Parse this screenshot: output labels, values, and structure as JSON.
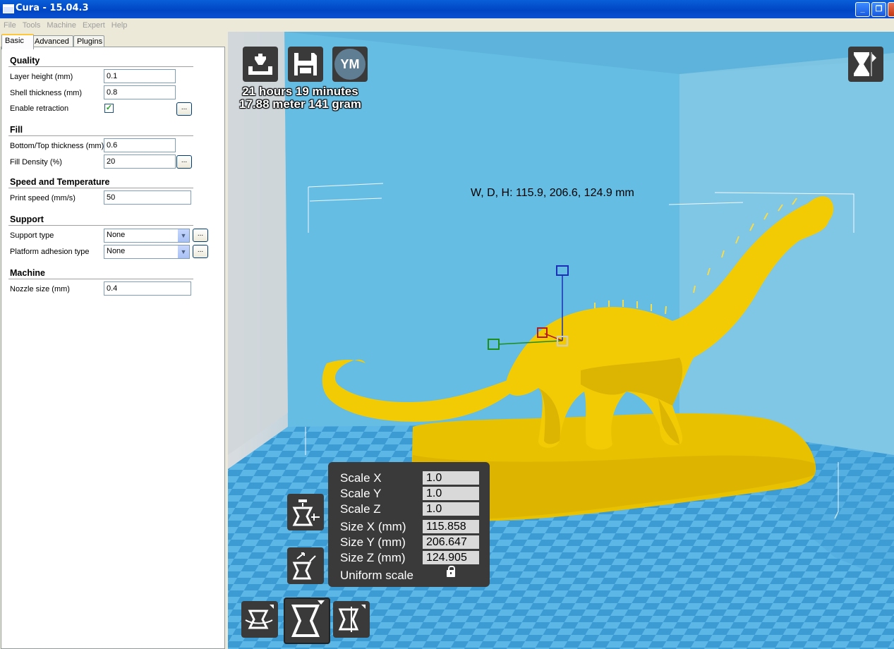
{
  "window": {
    "title": "Cura - 15.04.3"
  },
  "menu": [
    "File",
    "Tools",
    "Machine",
    "Expert",
    "Help"
  ],
  "tabs": [
    "Basic",
    "Advanced",
    "Plugins"
  ],
  "settings": {
    "quality": {
      "header": "Quality",
      "layer_height_label": "Layer height (mm)",
      "layer_height": "0.1",
      "shell_thickness_label": "Shell thickness (mm)",
      "shell_thickness": "0.8",
      "retraction_label": "Enable retraction",
      "retraction_checked": true
    },
    "fill": {
      "header": "Fill",
      "bottom_top_label": "Bottom/Top thickness (mm)",
      "bottom_top": "0.6",
      "density_label": "Fill Density (%)",
      "density": "20"
    },
    "speed": {
      "header": "Speed and Temperature",
      "print_speed_label": "Print speed (mm/s)",
      "print_speed": "50"
    },
    "support": {
      "header": "Support",
      "support_type_label": "Support type",
      "support_type": "None",
      "adhesion_label": "Platform adhesion type",
      "adhesion": "None"
    },
    "machine": {
      "header": "Machine",
      "nozzle_label": "Nozzle size (mm)",
      "nozzle": "0.4"
    },
    "dots_label": "..."
  },
  "viewport": {
    "print_time": "21 hours 19 minutes",
    "print_material": "17.88 meter 141 gram",
    "ym_label": "YM",
    "dimensions": "W, D, H: 115.9, 206.6, 124.9 mm",
    "model_color": "#f2cb05",
    "scale_panel": {
      "scale_x_label": "Scale X",
      "scale_x": "1.0",
      "scale_y_label": "Scale Y",
      "scale_y": "1.0",
      "scale_z_label": "Scale Z",
      "scale_z": "1.0",
      "size_x_label": "Size X (mm)",
      "size_x": "115.858",
      "size_y_label": "Size Y (mm)",
      "size_y": "206.647",
      "size_z_label": "Size Z (mm)",
      "size_z": "124.905",
      "uniform_label": "Uniform scale"
    }
  }
}
